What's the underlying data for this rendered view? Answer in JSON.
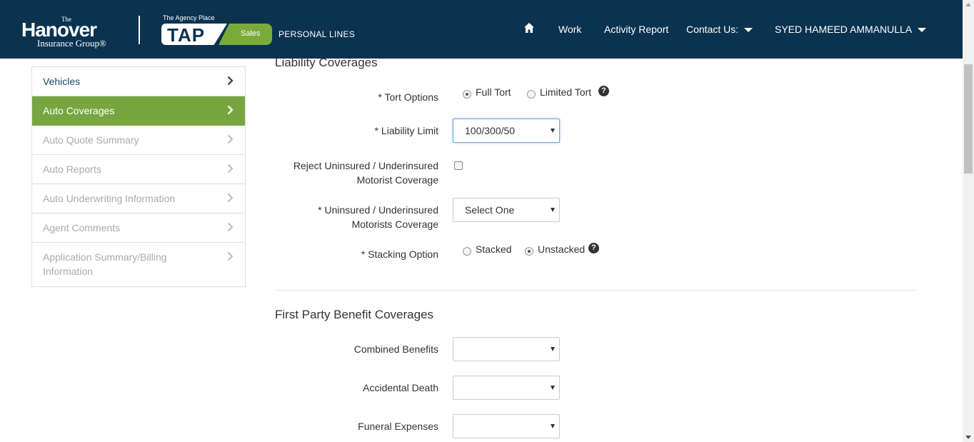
{
  "header": {
    "logo_the": "The",
    "logo_main": "Hanover",
    "logo_sub": "Insurance Group®",
    "tap_tagline": "The Agency Place",
    "tap_text": "TAP",
    "tap_badge": "Sales",
    "product_line": "PERSONAL LINES",
    "nav": {
      "home_icon": "home-icon",
      "work": "Work",
      "activity_report": "Activity Report",
      "contact_us": "Contact Us:",
      "user": "SYED HAMEED AMMANULLA"
    },
    "colors": {
      "background": "#0b3350",
      "accent": "#7aab3a"
    }
  },
  "sidebar": {
    "items": [
      {
        "label": "Vehicles",
        "state": "link"
      },
      {
        "label": "Auto Coverages",
        "state": "active"
      },
      {
        "label": "Auto Quote Summary",
        "state": "disabled"
      },
      {
        "label": "Auto Reports",
        "state": "disabled"
      },
      {
        "label": "Auto Underwriting Information",
        "state": "disabled"
      },
      {
        "label": "Agent Comments",
        "state": "disabled"
      },
      {
        "label": "Application Summary/Billing Information",
        "state": "disabled"
      }
    ],
    "colors": {
      "active": "#77a640"
    }
  },
  "liability": {
    "title": "Liability Coverages",
    "tort_label": "* Tort Options",
    "tort_full": "Full Tort",
    "tort_limited": "Limited Tort",
    "tort_selected": "Full Tort",
    "limit_label": "* Liability Limit",
    "limit_value": "100/300/50",
    "reject_label_1": "Reject Uninsured / Underinsured",
    "reject_label_2": "Motorist Coverage",
    "reject_checked": false,
    "um_label_1": "* Uninsured / Underinsured",
    "um_label_2": "Motorists Coverage",
    "um_value": "Select One",
    "stacking_label": "* Stacking Option",
    "stacking_stacked": "Stacked",
    "stacking_unstacked": "Unstacked",
    "stacking_selected": "Unstacked",
    "help_glyph": "?"
  },
  "first_party": {
    "title": "First Party Benefit Coverages",
    "combined_label": "Combined Benefits",
    "combined_value": "",
    "accidental_label": "Accidental Death",
    "accidental_value": "",
    "funeral_label": "Funeral Expenses",
    "funeral_value": ""
  }
}
